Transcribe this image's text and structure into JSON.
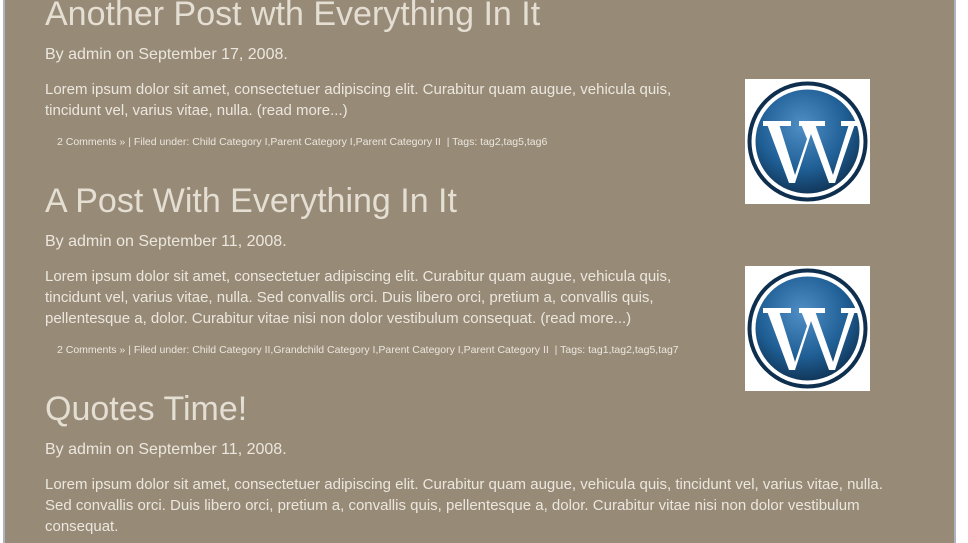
{
  "posts": [
    {
      "title": "Another Post wth Everything In It",
      "byline": "By admin on September 17, 2008.",
      "excerpt": "Lorem ipsum dolor sit amet, consectetuer adipiscing elit. Curabitur quam augue, vehicula quis, tincidunt vel, varius vitae, nulla.",
      "read_more": "(read more...)",
      "comments": "2 Comments »",
      "filed_prefix": "| Filed under:",
      "categories": "Child Category I,Parent Category I,Parent Category II",
      "tags_prefix": "| Tags:",
      "tags": "tag2,tag5,tag6",
      "thumb_icon": "wordpress-logo-icon"
    },
    {
      "title": "A Post With Everything In It",
      "byline": "By admin on September 11, 2008.",
      "excerpt": "Lorem ipsum dolor sit amet, consectetuer adipiscing elit. Curabitur quam augue, vehicula quis, tincidunt vel, varius vitae, nulla. Sed convallis orci. Duis libero orci, pretium a, convallis quis, pellentesque a, dolor. Curabitur vitae nisi non dolor vestibulum consequat.",
      "read_more": "(read more...)",
      "comments": "2 Comments »",
      "filed_prefix": "| Filed under:",
      "categories": "Child Category II,Grandchild Category I,Parent Category I,Parent Category II",
      "tags_prefix": "| Tags:",
      "tags": "tag1,tag2,tag5,tag7",
      "thumb_icon": "wordpress-logo-icon"
    },
    {
      "title": "Quotes Time!",
      "byline": "By admin on September 11, 2008.",
      "excerpt": "Lorem ipsum dolor sit amet, consectetuer adipiscing elit. Curabitur quam augue, vehicula quis, tincidunt vel, varius vitae, nulla. Sed convallis orci. Duis libero orci, pretium a, convallis quis, pellentesque a, dolor. Curabitur vitae nisi non dolor vestibulum consequat."
    }
  ],
  "colors": {
    "background": "#978a77",
    "text": "#ece7de",
    "logo_blue": "#1f5f95",
    "frame_border": "#aeb3c0"
  }
}
